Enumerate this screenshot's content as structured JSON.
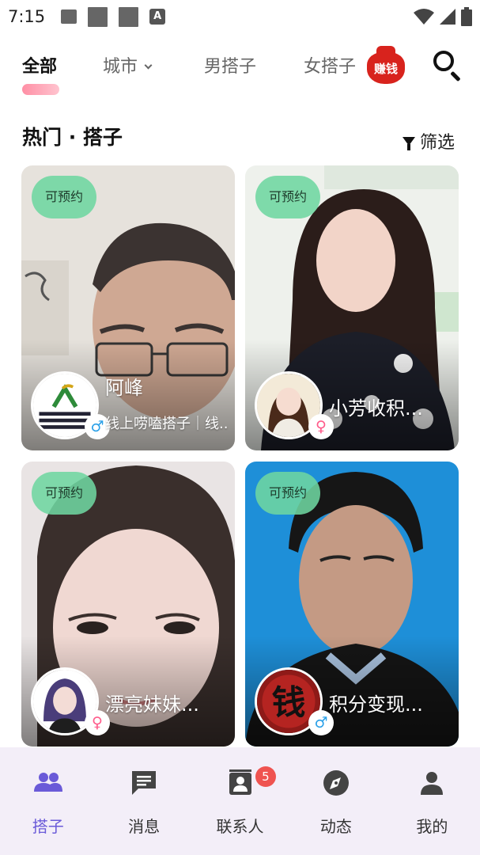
{
  "status_bar": {
    "time": "7:15",
    "icons": [
      "image-icon",
      "square-icon",
      "square-icon",
      "text-a-icon",
      "wifi-icon",
      "signal-icon",
      "battery-icon"
    ]
  },
  "top_tabs": {
    "items": [
      {
        "label": "全部",
        "active": true
      },
      {
        "label": "城市",
        "has_dropdown": true
      },
      {
        "label": "男搭子"
      },
      {
        "label": "女搭子"
      }
    ],
    "promo_label": "赚钱",
    "search_icon": "search-icon"
  },
  "section": {
    "title": "热门 · 搭子",
    "filter_label": "筛选"
  },
  "cards": [
    {
      "badge": "可预约",
      "name": "阿峰",
      "subtitle": "线上唠嗑搭子｜线...",
      "gender": "♂",
      "gender_type": "male"
    },
    {
      "badge": "可预约",
      "name": "小芳收积...",
      "subtitle": "",
      "gender": "♀",
      "gender_type": "female"
    },
    {
      "badge": "可预约",
      "name": "漂亮妹妹...",
      "subtitle": "",
      "gender": "♀",
      "gender_type": "female"
    },
    {
      "badge": "可预约",
      "name": "积分变现...",
      "subtitle": "",
      "gender": "♂",
      "gender_type": "male",
      "avatar_text": "钱"
    }
  ],
  "bottom_nav": {
    "items": [
      {
        "label": "搭子",
        "icon": "people-icon",
        "active": true
      },
      {
        "label": "消息",
        "icon": "chat-icon"
      },
      {
        "label": "联系人",
        "icon": "contacts-icon",
        "badge": "5"
      },
      {
        "label": "动态",
        "icon": "compass-icon"
      },
      {
        "label": "我的",
        "icon": "person-icon"
      }
    ]
  },
  "colors": {
    "accent": "#6a5ad8",
    "badge_green": "#6ed6a0",
    "tab_indicator": "#ff8fa5",
    "nav_bg": "#f3eef8",
    "notification_red": "#ef5350"
  }
}
